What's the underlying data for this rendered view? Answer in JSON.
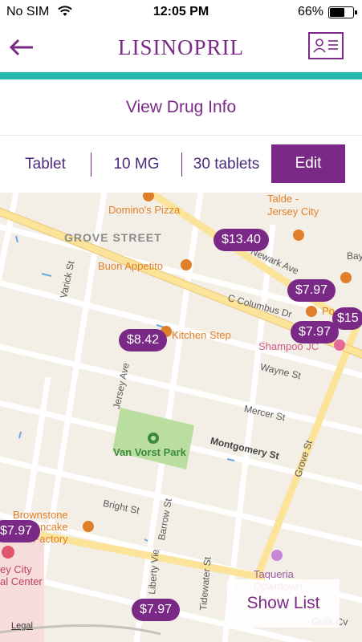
{
  "status_bar": {
    "carrier": "No SIM",
    "time": "12:05 PM",
    "battery_percent": "66%",
    "battery_level": 0.66
  },
  "header": {
    "title": "LISINOPRIL",
    "back_icon": "back-arrow-icon",
    "card_icon": "id-card-icon"
  },
  "drug_info_link": "View Drug Info",
  "options": {
    "form": "Tablet",
    "dosage": "10 MG",
    "quantity": "30 tablets",
    "edit_label": "Edit"
  },
  "map": {
    "neighborhood": "GROVE STREET",
    "pois": {
      "dominos": "Domino's Pizza",
      "talde": "Talde -\nJersey City",
      "buon_appetito": "Buon Appetito",
      "kitchen_step": "Kitchen Step",
      "shampoo": "Shampoo JC",
      "brownstone": "Brownstone\nPancake\nFactory",
      "medical_center": "ey City\nal Center",
      "taqueria": "Taqueria\nDowntown",
      "po": "Po"
    },
    "park": "Van Vorst Park",
    "streets": {
      "varick": "Varick St",
      "jersey_ave": "Jersey Ave",
      "newark": "Newark Ave",
      "columbus": "C Columbus Dr",
      "wayne": "Wayne St",
      "mercer": "Mercer St",
      "montgomery": "Montgomery St",
      "grove": "Grove St",
      "bright": "Bright St",
      "barrow": "Barrow St",
      "liberty": "Liberty Vie",
      "tidewater": "Tidewater St",
      "bay": "Bay",
      "gulls": "Gulls Cv"
    },
    "prices": [
      "$13.40",
      "$7.97",
      "$7.97",
      "$15",
      "$8.42",
      "$7.97",
      "$7.97"
    ]
  },
  "show_list_label": "Show List",
  "legal_label": "Legal",
  "colors": {
    "brand_purple": "#7a2a86",
    "accent_teal": "#27b9ad",
    "map_background": "#f4efe6",
    "park_green": "#b9dea0",
    "major_road": "#fbe39a"
  }
}
